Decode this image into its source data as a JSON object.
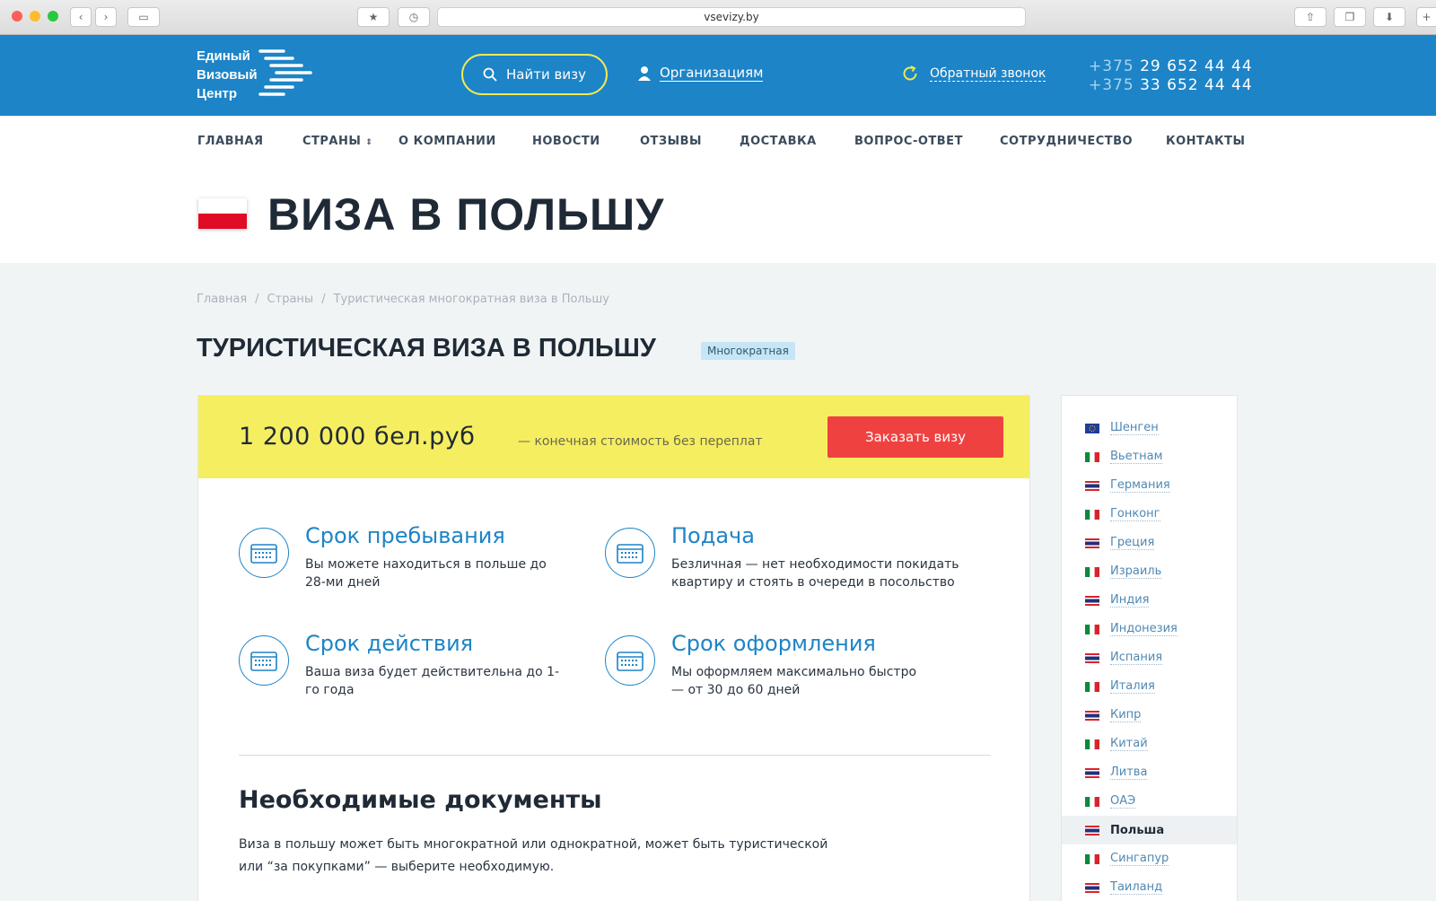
{
  "browser": {
    "url": "vsevizy.by"
  },
  "header": {
    "logo_lines": [
      "Единый",
      "Визовый",
      "Центр"
    ],
    "find_visa": "Найти визу",
    "organizations": "Организациям",
    "callback": "Обратный звонок",
    "phones": [
      {
        "code": "+375",
        "number": "29 652 44 44"
      },
      {
        "code": "+375",
        "number": "33 652 44 44"
      }
    ]
  },
  "nav": [
    "ГЛАВНАЯ",
    "СТРАНЫ",
    "О КОМПАНИИ",
    "НОВОСТИ",
    "ОТЗЫВЫ",
    "ДОСТАВКА",
    "ВОПРОС-ОТВЕТ",
    "СОТРУДНИЧЕСТВО",
    "КОНТАКТЫ"
  ],
  "page": {
    "title": "ВИЗА В ПОЛЬШУ"
  },
  "breadcrumb": [
    "Главная",
    "Страны",
    "Туристическая многократная виза в Польшу"
  ],
  "visa": {
    "title": "ТУРИСТИЧЕСКАЯ ВИЗА В ПОЛЬШУ",
    "badge": "Многократная",
    "price": "1 200 000 бел.руб",
    "price_note": "— конечная стоимость без переплат",
    "order_button": "Заказать визу",
    "features": [
      {
        "title": "Срок пребывания",
        "text": "Вы можете находиться в польше до 28-ми дней"
      },
      {
        "title": "Подача",
        "text": "Безличная — нет необходимости покидать квартиру и стоять в очереди в посольство"
      },
      {
        "title": "Срок действия",
        "text": "Ваша виза будет действительна до 1-го года"
      },
      {
        "title": "Срок оформления",
        "text": "Мы оформляем максимально быстро — от 30 до 60 дней"
      }
    ],
    "docs_title": "Необходимые документы",
    "docs_text": "Виза в польшу может быть многократной или однократной, может быть туристической или “за покупками” — выберите необходимую."
  },
  "sidebar": {
    "countries": [
      "Шенген",
      "Вьетнам",
      "Германия",
      "Гонконг",
      "Греция",
      "Израиль",
      "Индия",
      "Индонезия",
      "Испания",
      "Италия",
      "Кипр",
      "Китай",
      "Литва",
      "ОАЭ",
      "Польша",
      "Сингапур",
      "Таиланд"
    ],
    "active": "Польша"
  },
  "colors": {
    "brand_blue": "#1d84c7",
    "yellow": "#f6ee61",
    "order_red": "#f04141"
  }
}
